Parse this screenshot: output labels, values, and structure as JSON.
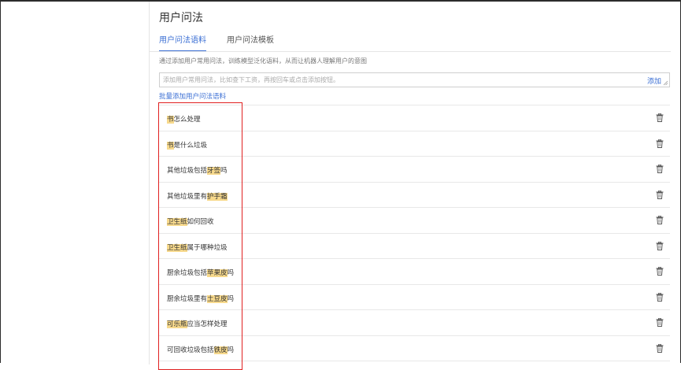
{
  "page": {
    "title": "用户问法"
  },
  "tabs": [
    {
      "label": "用户问法语料",
      "active": true
    },
    {
      "label": "用户问法模板",
      "active": false
    }
  ],
  "description": "通过添加用户常用问法，训练模型泛化语料，从而让机器人理解用户的意图",
  "input": {
    "placeholder": "添加用户常用问法，比如查下工资，再按回车或点击添加按钮。",
    "value": "",
    "add_label": "添加"
  },
  "batch_add_label": "批量添加用户问法语料",
  "corpus": [
    {
      "parts": [
        {
          "text": "书",
          "hl": true
        },
        {
          "text": "怎么处理",
          "hl": false
        }
      ]
    },
    {
      "parts": [
        {
          "text": "书",
          "hl": true
        },
        {
          "text": "是什么垃圾",
          "hl": false
        }
      ]
    },
    {
      "parts": [
        {
          "text": "其他垃圾包括",
          "hl": false
        },
        {
          "text": "牙签",
          "hl": true
        },
        {
          "text": "吗",
          "hl": false
        }
      ]
    },
    {
      "parts": [
        {
          "text": "其他垃圾里有",
          "hl": false
        },
        {
          "text": "护手霜",
          "hl": true
        }
      ]
    },
    {
      "parts": [
        {
          "text": "卫生纸",
          "hl": true
        },
        {
          "text": "如何回收",
          "hl": false
        }
      ]
    },
    {
      "parts": [
        {
          "text": "卫生纸",
          "hl": true
        },
        {
          "text": "属于哪种垃圾",
          "hl": false
        }
      ]
    },
    {
      "parts": [
        {
          "text": "厨余垃圾包括",
          "hl": false
        },
        {
          "text": "苹果皮",
          "hl": true
        },
        {
          "text": "吗",
          "hl": false
        }
      ]
    },
    {
      "parts": [
        {
          "text": "厨余垃圾里有",
          "hl": false
        },
        {
          "text": "土豆皮",
          "hl": true
        },
        {
          "text": "吗",
          "hl": false
        }
      ]
    },
    {
      "parts": [
        {
          "text": "可乐瓶",
          "hl": true
        },
        {
          "text": "应当怎样处理",
          "hl": false
        }
      ]
    },
    {
      "parts": [
        {
          "text": "可回收垃圾包括",
          "hl": false
        },
        {
          "text": "铁皮",
          "hl": true
        },
        {
          "text": "吗",
          "hl": false
        }
      ]
    }
  ],
  "icons": {
    "delete": "trash-icon"
  },
  "colors": {
    "accent": "#3b6fd4",
    "highlight": "#f7d98c",
    "annotation": "#e02020"
  }
}
